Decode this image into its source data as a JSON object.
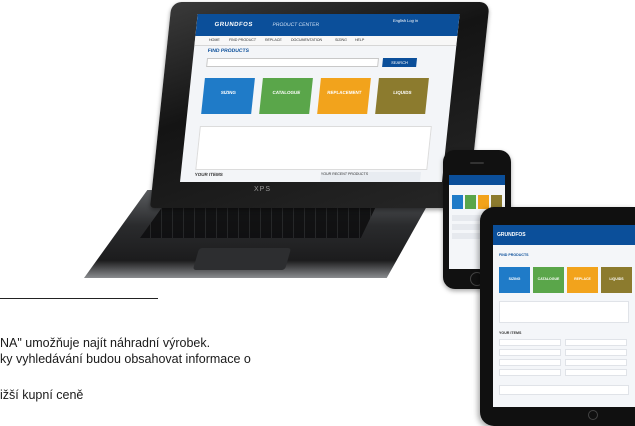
{
  "laptop": {
    "brand_label": "XPS",
    "screen": {
      "logo": "GRUNDFOS",
      "logo_sub": "PRODUCT CENTER",
      "top_right": "English   Log in",
      "nav": [
        "HOME",
        "FIND PRODUCT",
        "REPLACE",
        "DOCUMENTATION",
        "SIZING",
        "HELP"
      ],
      "page_title": "FIND PRODUCTS",
      "search_button": "SEARCH",
      "tiles": [
        {
          "label": "SIZING",
          "color": "#1f7bc8"
        },
        {
          "label": "CATALOGUE",
          "color": "#5aa64a"
        },
        {
          "label": "REPLACEMENT",
          "color": "#f2a31c"
        },
        {
          "label": "LIQUIDS",
          "color": "#8c7b2e"
        }
      ],
      "your_items": "YOUR ITEMS",
      "recent_products": "YOUR RECENT PRODUCTS"
    }
  },
  "tablet": {
    "logo": "GRUNDFOS",
    "page_title": "FIND PRODUCTS",
    "tiles": [
      {
        "label": "SIZING",
        "color": "#1f7bc8"
      },
      {
        "label": "CATALOGUE",
        "color": "#5aa64a"
      },
      {
        "label": "REPLACE",
        "color": "#f2a31c"
      },
      {
        "label": "LIQUIDS",
        "color": "#8c7b2e"
      }
    ],
    "your_items": "YOUR ITEMS"
  },
  "phone": {
    "tiles": [
      {
        "color": "#1f7bc8"
      },
      {
        "color": "#5aa64a"
      },
      {
        "color": "#f2a31c"
      },
      {
        "color": "#8c7b2e"
      }
    ]
  },
  "text": {
    "line1": "NA\" umožňuje najít náhradní výrobek.",
    "line2": "ky vyhledávání budou obsahovat informace o",
    "line3": "ižší kupní ceně"
  }
}
